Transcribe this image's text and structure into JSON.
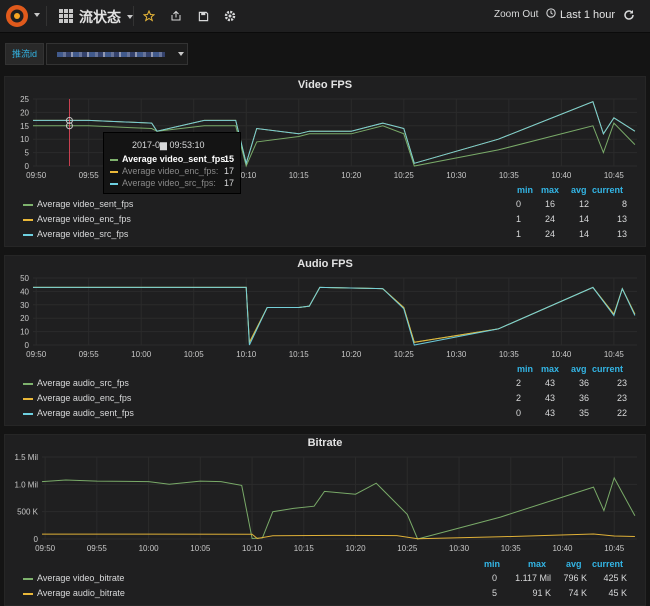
{
  "colors": {
    "green": "#7eb26d",
    "orange": "#eab839",
    "blue": "#6ed0e0",
    "accent": "#33b5e5",
    "grid": "#2b2b2b"
  },
  "navbar": {
    "logo_icon": "grafana-logo",
    "dashboard_icon": "grid-icon",
    "dashboard_title": "流状态",
    "star_icon": "star-icon",
    "share_icon": "share-icon",
    "save_icon": "save-icon",
    "settings_icon": "gear-icon",
    "zoom_out": "Zoom Out",
    "time_range": "Last 1 hour",
    "refresh_icon": "refresh-icon"
  },
  "variables": {
    "label": "推流id"
  },
  "legend_headers": {
    "min": "min",
    "max": "max",
    "avg": "avg",
    "current": "current"
  },
  "panels": [
    {
      "title": "Video FPS",
      "legend": [
        {
          "name": "Average video_sent_fps",
          "color": "#7eb26d",
          "min": "0",
          "max": "16",
          "avg": "12",
          "current": "8"
        },
        {
          "name": "Average video_enc_fps",
          "color": "#eab839",
          "min": "1",
          "max": "24",
          "avg": "14",
          "current": "13"
        },
        {
          "name": "Average video_src_fps",
          "color": "#6ed0e0",
          "min": "1",
          "max": "24",
          "avg": "14",
          "current": "13"
        }
      ],
      "tooltip": {
        "time": "2017-0▆ 09:53:10",
        "rows": [
          {
            "name": "Average video_sent_fps:",
            "value": "15",
            "color": "#7eb26d"
          },
          {
            "name": "Average video_enc_fps:",
            "value": "17",
            "color": "#eab839"
          },
          {
            "name": "Average video_src_fps:",
            "value": "17",
            "color": "#6ed0e0"
          }
        ]
      }
    },
    {
      "title": "Audio FPS",
      "legend": [
        {
          "name": "Average audio_src_fps",
          "color": "#7eb26d",
          "min": "2",
          "max": "43",
          "avg": "36",
          "current": "23"
        },
        {
          "name": "Average audio_enc_fps",
          "color": "#eab839",
          "min": "2",
          "max": "43",
          "avg": "36",
          "current": "23"
        },
        {
          "name": "Average audio_sent_fps",
          "color": "#6ed0e0",
          "min": "0",
          "max": "43",
          "avg": "35",
          "current": "22"
        }
      ]
    },
    {
      "title": "Bitrate",
      "legend": [
        {
          "name": "Average video_bitrate",
          "color": "#7eb26d",
          "min": "0",
          "max": "1.117 Mil",
          "avg": "796 K",
          "current": "425 K"
        },
        {
          "name": "Average audio_bitrate",
          "color": "#eab839",
          "min": "5",
          "max": "91 K",
          "avg": "74 K",
          "current": "45 K"
        }
      ]
    }
  ],
  "chart_data": [
    {
      "type": "line",
      "title": "Video FPS",
      "categories": [
        "09:50",
        "09:55",
        "10:00",
        "10:05",
        "10:10",
        "10:15",
        "10:20",
        "10:25",
        "10:30",
        "10:35",
        "10:40",
        "10:45"
      ],
      "yticks": [
        "0",
        "5",
        "10",
        "15",
        "20",
        "25"
      ],
      "ylim": [
        0,
        25
      ],
      "xlim": [
        -0.3,
        57.2
      ],
      "series": [
        {
          "name": "Average video_sent_fps",
          "color": "#7eb26d",
          "points": [
            [
              -0.3,
              15
            ],
            [
              4,
              15
            ],
            [
              5,
              15
            ],
            [
              11,
              14
            ],
            [
              11.5,
              13
            ],
            [
              16,
              15
            ],
            [
              19,
              15
            ],
            [
              20,
              0
            ],
            [
              21,
              9
            ],
            [
              25,
              11
            ],
            [
              26,
              12
            ],
            [
              30,
              12
            ],
            [
              33,
              15
            ],
            [
              35,
              12
            ],
            [
              36,
              0
            ],
            [
              44,
              6
            ],
            [
              53,
              15
            ],
            [
              54,
              5
            ],
            [
              55,
              16
            ],
            [
              57,
              8
            ]
          ]
        },
        {
          "name": "Average video_enc_fps",
          "color": "#eab839",
          "points": [
            [
              -0.3,
              17
            ],
            [
              4,
              17
            ],
            [
              5,
              17
            ],
            [
              11,
              16
            ],
            [
              11.5,
              13
            ],
            [
              16,
              17
            ],
            [
              19,
              17
            ],
            [
              20,
              1
            ],
            [
              21,
              14
            ],
            [
              25,
              12
            ],
            [
              26,
              13
            ],
            [
              30,
              13
            ],
            [
              33,
              16
            ],
            [
              35,
              14
            ],
            [
              36,
              1
            ],
            [
              44,
              10
            ],
            [
              53,
              24
            ],
            [
              54,
              12
            ],
            [
              55,
              18
            ],
            [
              57,
              13
            ]
          ]
        },
        {
          "name": "Average video_src_fps",
          "color": "#6ed0e0",
          "points": [
            [
              -0.3,
              17
            ],
            [
              4,
              17
            ],
            [
              5,
              17
            ],
            [
              11,
              16
            ],
            [
              11.5,
              13
            ],
            [
              16,
              17
            ],
            [
              19,
              17
            ],
            [
              20,
              1
            ],
            [
              21,
              14
            ],
            [
              25,
              12
            ],
            [
              26,
              13
            ],
            [
              30,
              13
            ],
            [
              33,
              16
            ],
            [
              35,
              14
            ],
            [
              36,
              1
            ],
            [
              44,
              10
            ],
            [
              53,
              24
            ],
            [
              54,
              12
            ],
            [
              55,
              18
            ],
            [
              57,
              13
            ]
          ]
        }
      ]
    },
    {
      "type": "line",
      "title": "Audio FPS",
      "categories": [
        "09:50",
        "09:55",
        "10:00",
        "10:05",
        "10:10",
        "10:15",
        "10:20",
        "10:25",
        "10:30",
        "10:35",
        "10:40",
        "10:45"
      ],
      "yticks": [
        "0",
        "10",
        "20",
        "30",
        "40",
        "50"
      ],
      "ylim": [
        0,
        50
      ],
      "xlim": [
        -0.3,
        57.2
      ],
      "series": [
        {
          "name": "Average audio_src_fps",
          "color": "#7eb26d",
          "points": [
            [
              -0.3,
              43
            ],
            [
              20,
              43
            ],
            [
              20.3,
              2
            ],
            [
              22,
              28
            ],
            [
              25,
              28
            ],
            [
              26,
              29
            ],
            [
              27,
              43
            ],
            [
              33,
              42
            ],
            [
              35,
              28
            ],
            [
              36,
              2
            ],
            [
              44,
              12
            ],
            [
              53,
              43
            ],
            [
              55,
              23
            ],
            [
              55.8,
              42
            ],
            [
              57,
              23
            ]
          ]
        },
        {
          "name": "Average audio_enc_fps",
          "color": "#eab839",
          "points": [
            [
              -0.3,
              43
            ],
            [
              20,
              43
            ],
            [
              20.3,
              2
            ],
            [
              22,
              28
            ],
            [
              25,
              28
            ],
            [
              26,
              29
            ],
            [
              27,
              43
            ],
            [
              33,
              42
            ],
            [
              35,
              28
            ],
            [
              36,
              2
            ],
            [
              44,
              12
            ],
            [
              53,
              43
            ],
            [
              55,
              23
            ],
            [
              55.8,
              42
            ],
            [
              57,
              23
            ]
          ]
        },
        {
          "name": "Average audio_sent_fps",
          "color": "#6ed0e0",
          "points": [
            [
              -0.3,
              43
            ],
            [
              20,
              43
            ],
            [
              20.3,
              0
            ],
            [
              22,
              28
            ],
            [
              25,
              28
            ],
            [
              26,
              29
            ],
            [
              27,
              43
            ],
            [
              33,
              42
            ],
            [
              35,
              27
            ],
            [
              36,
              0
            ],
            [
              44,
              12
            ],
            [
              53,
              43
            ],
            [
              55,
              22
            ],
            [
              55.8,
              42
            ],
            [
              57,
              22
            ]
          ]
        }
      ]
    },
    {
      "type": "line",
      "title": "Bitrate",
      "categories": [
        "09:50",
        "09:55",
        "10:00",
        "10:05",
        "10:10",
        "10:15",
        "10:20",
        "10:25",
        "10:30",
        "10:35",
        "10:40",
        "10:45"
      ],
      "yticks": [
        "0",
        "500 K",
        "1.0 Mil",
        "1.5 Mil"
      ],
      "ytick_values": [
        0,
        500,
        1000,
        1500
      ],
      "ylim": [
        0,
        1500
      ],
      "xlim": [
        -0.3,
        57.2
      ],
      "series": [
        {
          "name": "Average video_bitrate",
          "color": "#7eb26d",
          "points": [
            [
              -0.3,
              1050
            ],
            [
              2,
              1080
            ],
            [
              5,
              1060
            ],
            [
              10,
              1050
            ],
            [
              12,
              1000
            ],
            [
              15,
              1060
            ],
            [
              17,
              1050
            ],
            [
              19,
              980
            ],
            [
              20,
              10
            ],
            [
              21,
              20
            ],
            [
              22,
              500
            ],
            [
              24,
              560
            ],
            [
              26,
              600
            ],
            [
              27,
              870
            ],
            [
              30,
              820
            ],
            [
              32,
              1020
            ],
            [
              35,
              450
            ],
            [
              36,
              0
            ],
            [
              44,
              400
            ],
            [
              53,
              950
            ],
            [
              54,
              520
            ],
            [
              55,
              1117
            ],
            [
              57,
              425
            ]
          ]
        },
        {
          "name": "Average audio_bitrate",
          "color": "#eab839",
          "points": [
            [
              -0.3,
              90
            ],
            [
              10,
              90
            ],
            [
              20,
              88
            ],
            [
              20.5,
              10
            ],
            [
              22,
              60
            ],
            [
              28,
              65
            ],
            [
              34,
              62
            ],
            [
              36,
              5
            ],
            [
              44,
              40
            ],
            [
              53,
              91
            ],
            [
              55,
              55
            ],
            [
              57,
              45
            ]
          ]
        }
      ]
    }
  ]
}
